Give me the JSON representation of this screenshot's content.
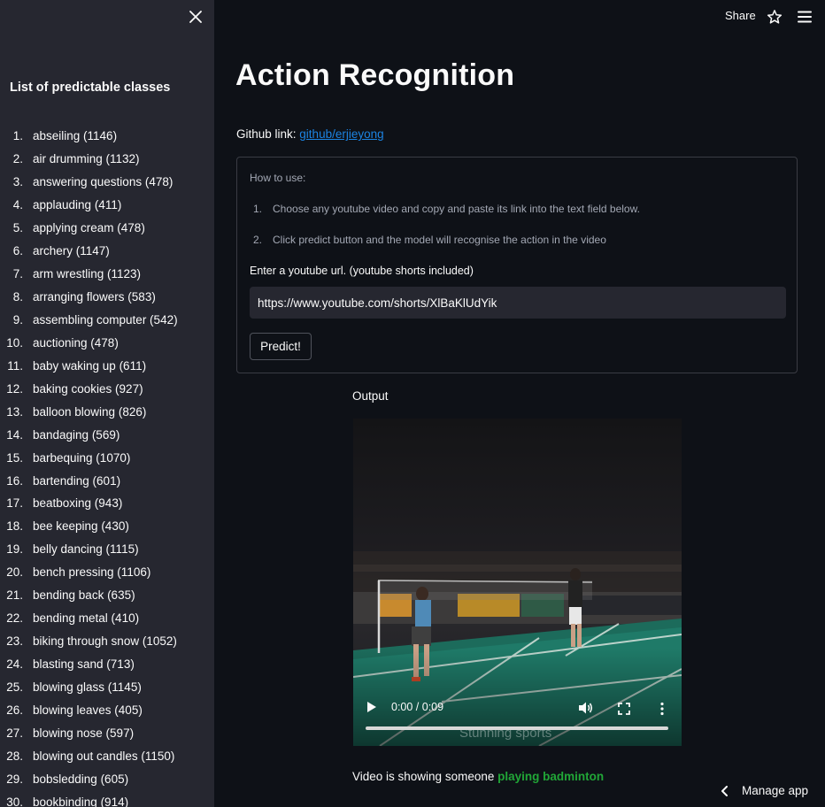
{
  "sidebar": {
    "title": "List of predictable classes",
    "classes": [
      {
        "num": "1.",
        "label": "abseiling (1146)"
      },
      {
        "num": "2.",
        "label": "air drumming (1132)"
      },
      {
        "num": "3.",
        "label": "answering questions (478)"
      },
      {
        "num": "4.",
        "label": "applauding (411)"
      },
      {
        "num": "5.",
        "label": "applying cream (478)"
      },
      {
        "num": "6.",
        "label": "archery (1147)"
      },
      {
        "num": "7.",
        "label": "arm wrestling (1123)"
      },
      {
        "num": "8.",
        "label": "arranging flowers (583)"
      },
      {
        "num": "9.",
        "label": "assembling computer (542)"
      },
      {
        "num": "10.",
        "label": "auctioning (478)"
      },
      {
        "num": "11.",
        "label": "baby waking up (611)"
      },
      {
        "num": "12.",
        "label": "baking cookies (927)"
      },
      {
        "num": "13.",
        "label": "balloon blowing (826)"
      },
      {
        "num": "14.",
        "label": "bandaging (569)"
      },
      {
        "num": "15.",
        "label": "barbequing (1070)"
      },
      {
        "num": "16.",
        "label": "bartending (601)"
      },
      {
        "num": "17.",
        "label": "beatboxing (943)"
      },
      {
        "num": "18.",
        "label": "bee keeping (430)"
      },
      {
        "num": "19.",
        "label": "belly dancing (1115)"
      },
      {
        "num": "20.",
        "label": "bench pressing (1106)"
      },
      {
        "num": "21.",
        "label": "bending back (635)"
      },
      {
        "num": "22.",
        "label": "bending metal (410)"
      },
      {
        "num": "23.",
        "label": "biking through snow (1052)"
      },
      {
        "num": "24.",
        "label": "blasting sand (713)"
      },
      {
        "num": "25.",
        "label": "blowing glass (1145)"
      },
      {
        "num": "26.",
        "label": "blowing leaves (405)"
      },
      {
        "num": "27.",
        "label": "blowing nose (597)"
      },
      {
        "num": "28.",
        "label": "blowing out candles (1150)"
      },
      {
        "num": "29.",
        "label": "bobsledding (605)"
      },
      {
        "num": "30.",
        "label": "bookbinding (914)"
      }
    ]
  },
  "topbar": {
    "share_label": "Share"
  },
  "main": {
    "title": "Action Recognition",
    "github_prefix": "Github link: ",
    "github_link_text": "github/erjieyong",
    "howto_title": "How to use:",
    "steps": [
      {
        "num": "1.",
        "text": "Choose any youtube video and copy and paste its link into the text field below."
      },
      {
        "num": "2.",
        "text": "Click predict button and the model will recognise the action in the video"
      }
    ],
    "url_label": "Enter a youtube url. (youtube shorts included)",
    "url_value": "https://www.youtube.com/shorts/XlBaKlUdYik",
    "predict_label": "Predict!",
    "output_label": "Output",
    "video": {
      "time": "0:00 / 0:09",
      "watermark": "Stunning sports",
      "progress": 0.0
    },
    "result_prefix": "Video is showing someone ",
    "result_action": "playing badminton"
  },
  "manage_app_label": "Manage app",
  "colors": {
    "accent_link": "#1c83e1",
    "result_green": "#21a637",
    "sidebar_bg": "#262730",
    "main_bg": "#0e1117"
  }
}
